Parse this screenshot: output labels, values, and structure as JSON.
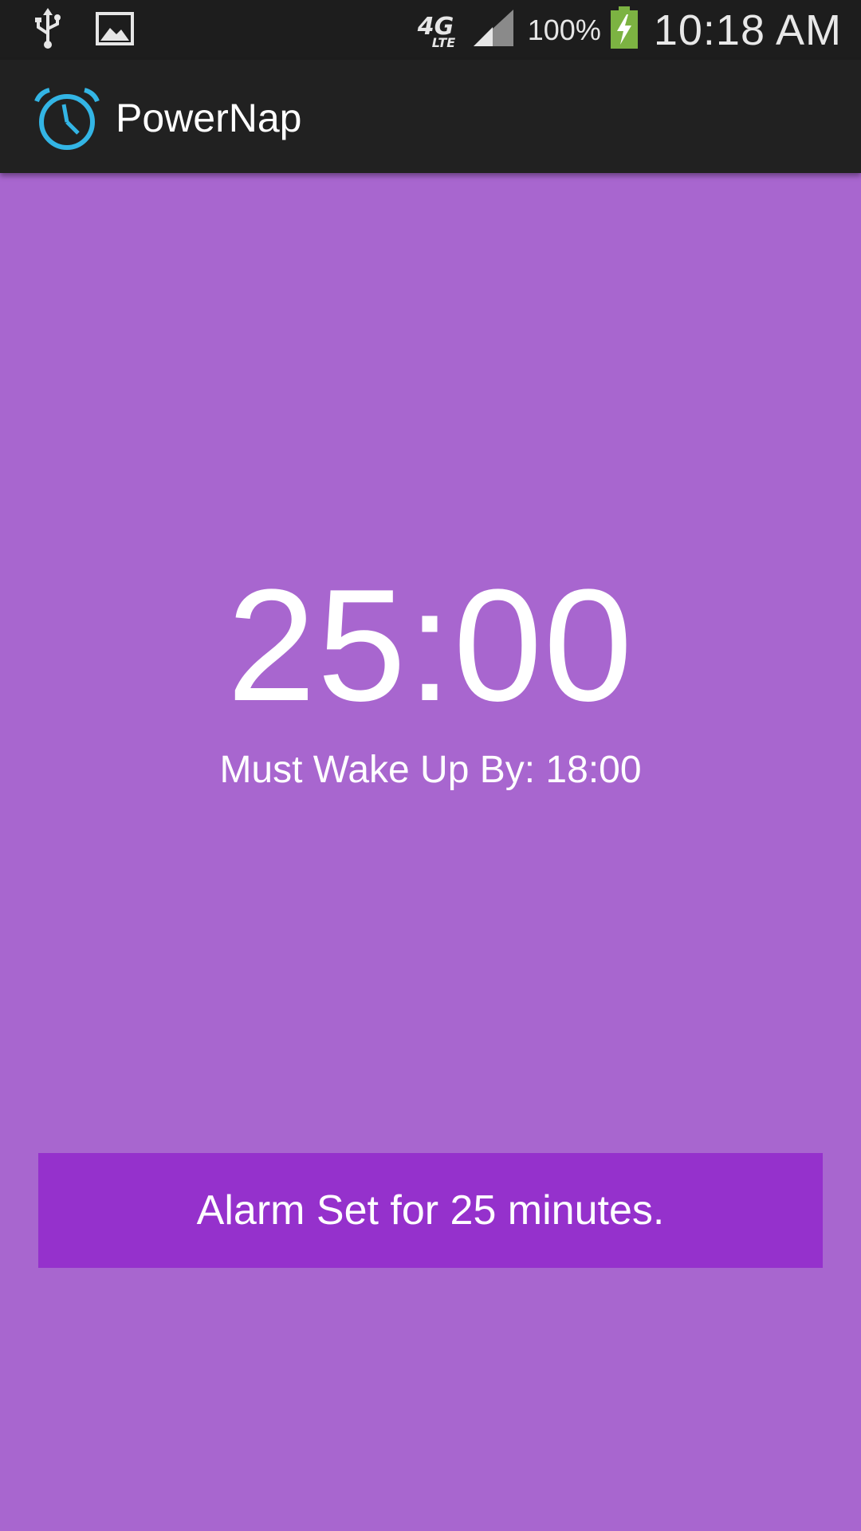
{
  "status_bar": {
    "icons_left": [
      "usb-icon",
      "image-icon"
    ],
    "network_label_main": "4G",
    "network_label_sub": "LTE",
    "battery_percent": "100%",
    "time": "10:18 AM"
  },
  "app_bar": {
    "title": "PowerNap",
    "icon": "alarm-clock-icon",
    "icon_color": "#33b5e5"
  },
  "main": {
    "timer": "25:00",
    "wake_up_text": "Must Wake Up By: 18:00",
    "alarm_button_label": "Alarm Set for 25 minutes.",
    "background_color": "#a866cf",
    "button_color": "#9531cc"
  }
}
